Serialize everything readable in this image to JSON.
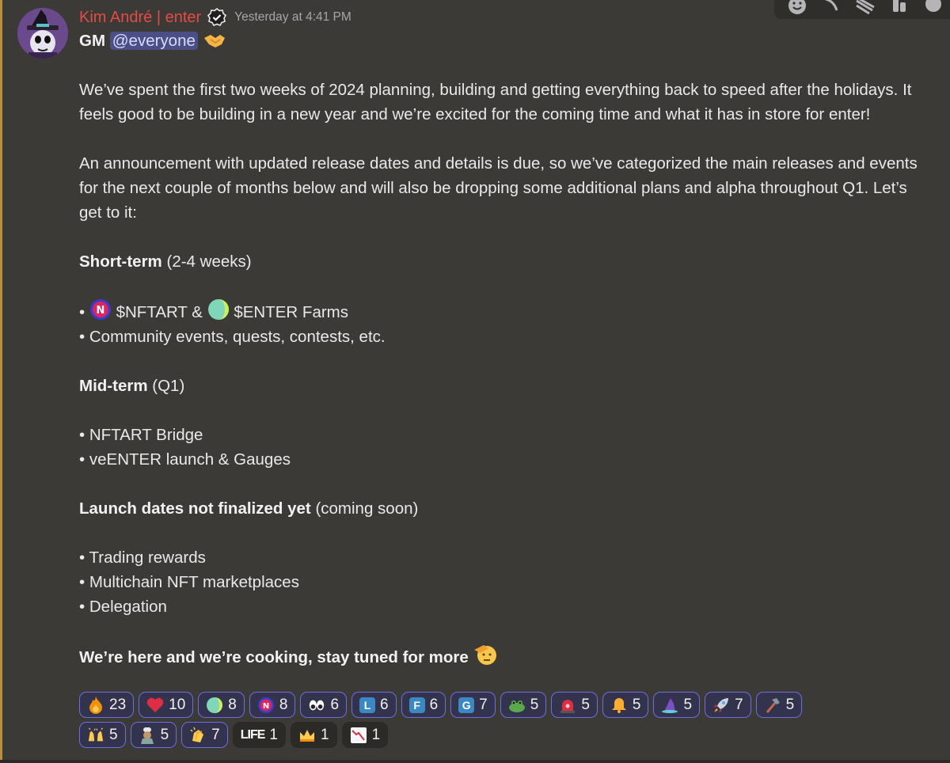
{
  "message": {
    "author": "Kim André | enter",
    "timestamp": "Yesterday at 4:41 PM",
    "greeting": "GM",
    "mention": "@everyone",
    "intro": "We’ve spent the first two weeks of 2024 planning, building and getting everything back to speed after the holidays. It feels good to be building in a new year and we’re excited for the coming time and what it has in store for enter!",
    "announcement": "An announcement with updated release dates and details is due, so we’ve categorized the main releases and events for the next couple of months below and will also be dropping some additional plans and alpha throughout Q1. Let’s get to it:",
    "short_term": {
      "title": "Short-term",
      "note": "(2-4 weeks)",
      "farm_bullet": {
        "prefix": "•",
        "token1": "$NFTART &",
        "token2": "$ENTER Farms"
      },
      "items": [
        "• Community events, quests, contests, etc."
      ]
    },
    "mid_term": {
      "title": "Mid-term",
      "note": "(Q1)",
      "items": [
        "• NFTART Bridge",
        "• veENTER launch & Gauges"
      ]
    },
    "launch": {
      "title": "Launch dates not finalized yet",
      "note": "(coming soon)",
      "items": [
        "• Trading rewards",
        "• Multichain NFT marketplaces",
        "• Delegation"
      ]
    },
    "closing": "We’re here and we’re cooking, stay tuned for more"
  },
  "reactions_row1": [
    {
      "emoji": "fire-icon",
      "count": "23",
      "active": true
    },
    {
      "emoji": "heart-icon",
      "count": "10",
      "active": true
    },
    {
      "emoji": "enter-token-icon",
      "count": "8",
      "active": true
    },
    {
      "emoji": "nftart-token-icon",
      "count": "8",
      "active": true
    },
    {
      "emoji": "eyes-icon",
      "count": "6",
      "active": true
    },
    {
      "emoji": "letter-l-icon",
      "letter": "L",
      "count": "6",
      "active": true
    },
    {
      "emoji": "letter-f-icon",
      "letter": "F",
      "count": "6",
      "active": true
    },
    {
      "emoji": "letter-g-icon",
      "letter": "G",
      "count": "7",
      "active": true
    },
    {
      "emoji": "frog-icon",
      "count": "5",
      "active": true
    },
    {
      "emoji": "siren-icon",
      "count": "5",
      "active": true
    },
    {
      "emoji": "bell-icon",
      "count": "5",
      "active": true
    },
    {
      "emoji": "wizard-hat-icon",
      "count": "5",
      "active": true
    },
    {
      "emoji": "rocket-icon",
      "count": "7",
      "active": true
    },
    {
      "emoji": "hammer-icon",
      "count": "5",
      "active": true
    }
  ],
  "reactions_row2": [
    {
      "emoji": "raised-hands-icon",
      "count": "5",
      "active": true
    },
    {
      "emoji": "cook-icon",
      "count": "5",
      "active": true
    },
    {
      "emoji": "clap-icon",
      "count": "7",
      "active": true
    },
    {
      "emoji": "life-icon",
      "label": "LIFE",
      "count": "1",
      "active": false
    },
    {
      "emoji": "crown-icon",
      "count": "1",
      "active": false
    },
    {
      "emoji": "chart-down-icon",
      "count": "1",
      "active": false
    }
  ],
  "colors": {
    "background": "#3c3a37",
    "username": "#e54b45",
    "mention_bg": "#4b4f86",
    "reaction_active_border": "#6b6ee0"
  }
}
